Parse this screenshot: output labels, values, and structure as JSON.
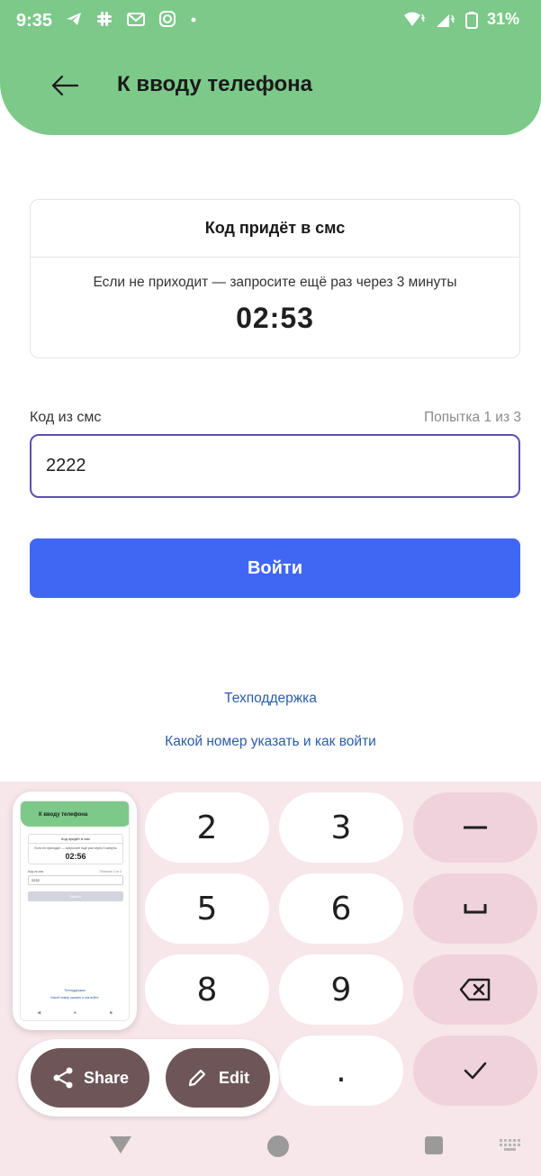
{
  "status_bar": {
    "time": "9:35",
    "battery": "31%",
    "left_icons": [
      "telegram-icon",
      "slack-icon",
      "gmail-icon",
      "instagram-icon",
      "dot-icon"
    ],
    "right_icons": [
      "wifi-icon",
      "signal-icon",
      "battery-icon"
    ]
  },
  "app_bar": {
    "title": "К вводу телефона",
    "back_icon": "arrow-left-icon",
    "color": "#7cc98a"
  },
  "code_card": {
    "title": "Код придёт в смс",
    "hint": "Если не приходит — запросите ещё раз через 3 минуты",
    "timer": "02:53"
  },
  "sms_field": {
    "label": "Код из смс",
    "attempt": "Попытка 1 из 3",
    "value": "2222",
    "border_color": "#5b51b3"
  },
  "login_button": {
    "label": "Войти",
    "color": "#3f67f4"
  },
  "links": {
    "support": "Техподдержка",
    "how_to": "Какой номер указать и как войти"
  },
  "keyboard": {
    "keys": [
      "2",
      "3",
      "5",
      "6",
      "8",
      "9",
      "."
    ],
    "func_keys": [
      "minus-icon",
      "space-icon",
      "backspace-icon",
      "check-icon"
    ],
    "background": "#f7e6ea"
  },
  "screenshot_preview": {
    "title": "К вводу телефона",
    "timer": "02:56",
    "input_value": "2222"
  },
  "screenshot_actions": {
    "share_label": "Share",
    "edit_label": "Edit",
    "share_icon": "share-icon",
    "edit_icon": "pencil-icon"
  },
  "nav_bar": {
    "icons": [
      "back-triangle-icon",
      "home-circle-icon",
      "recents-square-icon",
      "keyboard-switch-icon"
    ]
  }
}
